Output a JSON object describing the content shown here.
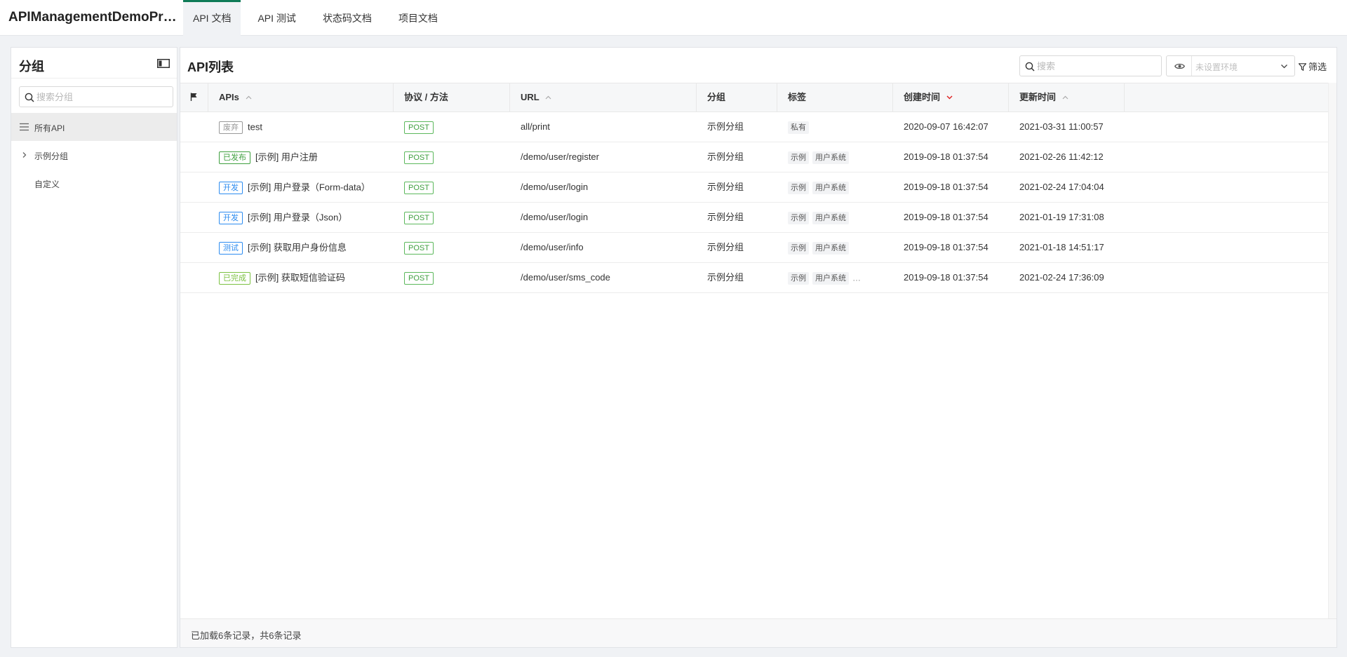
{
  "header": {
    "project_title": "APIManagementDemoProj…",
    "tabs": [
      {
        "label": "API 文档",
        "active": true
      },
      {
        "label": "API 测试",
        "active": false
      },
      {
        "label": "状态码文档",
        "active": false
      },
      {
        "label": "项目文档",
        "active": false
      }
    ]
  },
  "sidebar": {
    "title": "分组",
    "search_placeholder": "搜索分组",
    "items": [
      {
        "label": "所有API",
        "icon": "list-icon",
        "selected": true
      },
      {
        "label": "示例分组",
        "icon": "chevron-right-icon",
        "selected": false
      },
      {
        "label": "自定义",
        "icon": "",
        "selected": false
      }
    ]
  },
  "main": {
    "title": "API列表",
    "search_placeholder": "搜索",
    "env_placeholder": "未设置环境",
    "filter_label": "筛选",
    "columns": {
      "flag": "flag-icon",
      "apis": "APIs",
      "method": "协议 / 方法",
      "url": "URL",
      "group": "分组",
      "tags": "标签",
      "created": "创建时间",
      "updated": "更新时间"
    },
    "rows": [
      {
        "status": "废弃",
        "status_color": "#999999",
        "name": "test",
        "method": "POST",
        "url": "all/print",
        "group": "示例分组",
        "tags": [
          "私有"
        ],
        "more": "",
        "created": "2020-09-07 16:42:07",
        "updated": "2021-03-31 11:00:57"
      },
      {
        "status": "已发布",
        "status_color": "#3e9f3e",
        "name": "[示例] 用户注册",
        "method": "POST",
        "url": "/demo/user/register",
        "group": "示例分组",
        "tags": [
          "示例",
          "用户系统"
        ],
        "more": "",
        "created": "2019-09-18 01:37:54",
        "updated": "2021-02-26 11:42:12"
      },
      {
        "status": "开发",
        "status_color": "#2d8cf0",
        "name": "[示例] 用户登录（Form-data）",
        "method": "POST",
        "url": "/demo/user/login",
        "group": "示例分组",
        "tags": [
          "示例",
          "用户系统"
        ],
        "more": "",
        "created": "2019-09-18 01:37:54",
        "updated": "2021-02-24 17:04:04"
      },
      {
        "status": "开发",
        "status_color": "#2d8cf0",
        "name": "[示例] 用户登录（Json）",
        "method": "POST",
        "url": "/demo/user/login",
        "group": "示例分组",
        "tags": [
          "示例",
          "用户系统"
        ],
        "more": "",
        "created": "2019-09-18 01:37:54",
        "updated": "2021-01-19 17:31:08"
      },
      {
        "status": "测试",
        "status_color": "#2d8cf0",
        "name": "[示例] 获取用户身份信息",
        "method": "POST",
        "url": "/demo/user/info",
        "group": "示例分组",
        "tags": [
          "示例",
          "用户系统"
        ],
        "more": "",
        "created": "2019-09-18 01:37:54",
        "updated": "2021-01-18 14:51:17"
      },
      {
        "status": "已完成",
        "status_color": "#7cc142",
        "name": "[示例] 获取短信验证码",
        "method": "POST",
        "url": "/demo/user/sms_code",
        "group": "示例分组",
        "tags": [
          "示例",
          "用户系统"
        ],
        "more": "…",
        "created": "2019-09-18 01:37:54",
        "updated": "2021-02-24 17:36:09"
      }
    ],
    "footer_text": "已加载6条记录，共6条记录"
  },
  "colors": {
    "accent": "#0f7b57",
    "method_post": "#3e9f3e",
    "sort_active": "#e02020"
  }
}
